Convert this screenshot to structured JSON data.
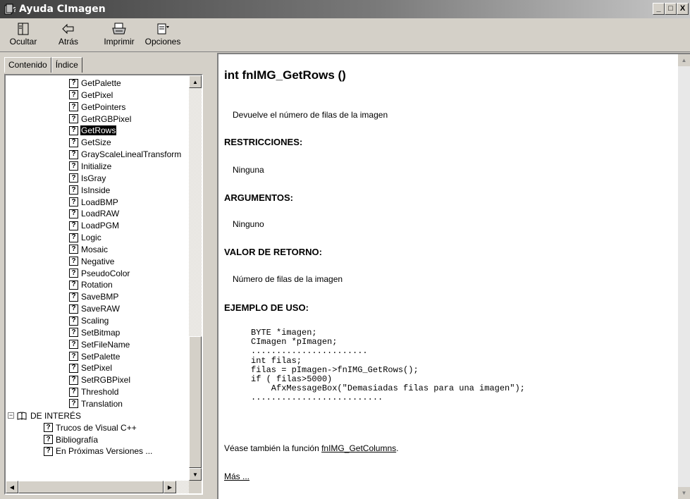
{
  "window": {
    "title": "Ayuda CImagen",
    "btn_min": "_",
    "btn_max": "□",
    "btn_close": "X"
  },
  "toolbar": [
    {
      "label": "Ocultar",
      "icon": "hide-icon"
    },
    {
      "label": "Atrás",
      "icon": "back-arrow-icon"
    },
    {
      "label": "Imprimir",
      "icon": "printer-icon"
    },
    {
      "label": "Opciones",
      "icon": "options-icon"
    }
  ],
  "tabs": {
    "contenido": "Contenido",
    "indice": "Índice"
  },
  "tree": {
    "items": [
      "GetPalette",
      "GetPixel",
      "GetPointers",
      "GetRGBPixel",
      "GetRows",
      "GetSize",
      "GrayScaleLinealTransform",
      "Initialize",
      "IsGray",
      "IsInside",
      "LoadBMP",
      "LoadRAW",
      "LoadPGM",
      "Logic",
      "Mosaic",
      "Negative",
      "PseudoColor",
      "Rotation",
      "SaveBMP",
      "SaveRAW",
      "Scaling",
      "SetBitmap",
      "SetFileName",
      "SetPalette",
      "SetPixel",
      "SetRGBPixel",
      "Threshold",
      "Translation"
    ],
    "selected": "GetRows",
    "book": "DE INTERÉS",
    "book_items": [
      "Trucos de Visual C++",
      "Bibliografía",
      "En Próximas Versiones ..."
    ],
    "help_glyph": "?"
  },
  "article": {
    "title": "int fnIMG_GetRows ()",
    "description": "Devuelve el número de filas de la imagen",
    "restricciones_h": "RESTRICCIONES:",
    "restricciones": "Ninguna",
    "argumentos_h": "ARGUMENTOS:",
    "argumentos": "Ninguno",
    "retorno_h": "VALOR DE RETORNO:",
    "retorno": "Número de filas de la imagen",
    "ejemplo_h": "EJEMPLO DE USO:",
    "code": "BYTE *imagen;\nCImagen *pImagen;\n.......................\nint filas;\nfilas = pImagen->fnIMG_GetRows();\nif ( filas>5000)\n    AfxMessageBox(\"Demasiadas filas para una imagen\");\n..........................",
    "see_also_prefix": "Véase también la función ",
    "see_also_link": "fnIMG_GetColumns",
    "see_also_suffix": ".",
    "more": "Más ..."
  }
}
